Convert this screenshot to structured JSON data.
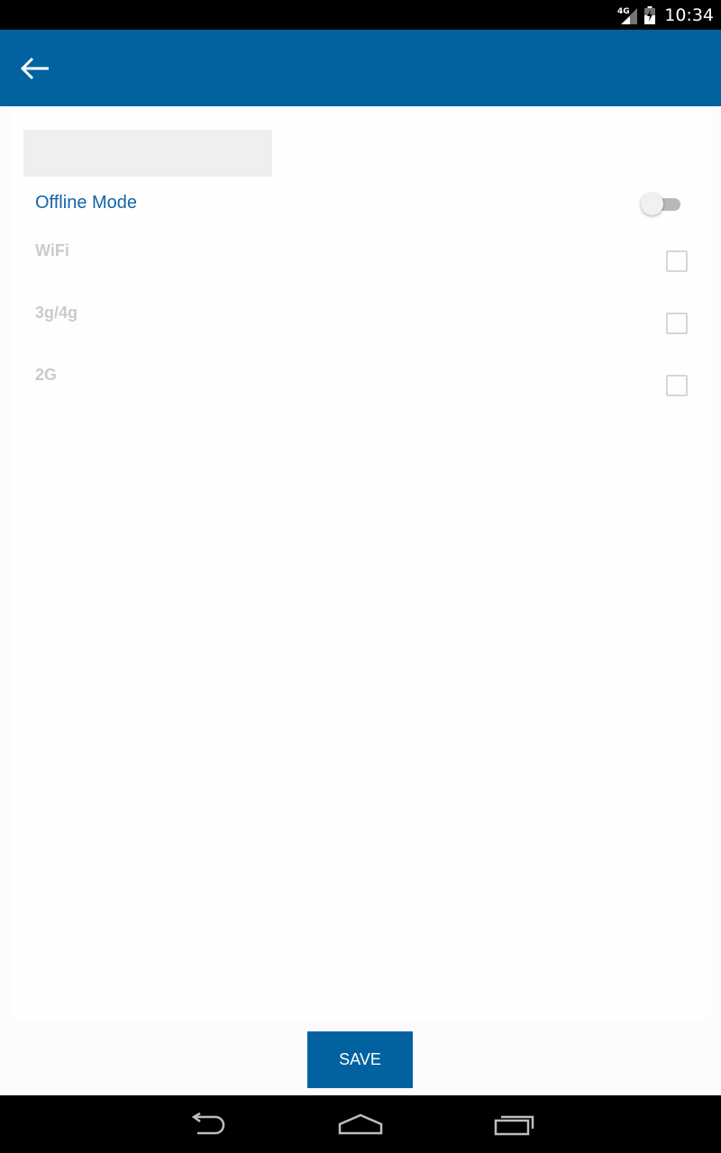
{
  "status_bar": {
    "network": "4G",
    "time": "10:34"
  },
  "settings": {
    "offline_mode": {
      "label": "Offline Mode",
      "enabled": false
    },
    "options": [
      {
        "label": "WiFi",
        "checked": false
      },
      {
        "label": "3g/4g",
        "checked": false
      },
      {
        "label": "2G",
        "checked": false
      }
    ]
  },
  "actions": {
    "save_label": "SAVE"
  },
  "colors": {
    "primary": "#0262a0",
    "label_blue": "#1565a6",
    "disabled_text": "#cbcbcb"
  },
  "icons": {
    "app_bar": "arrow-back-icon",
    "nav": [
      "nav-back-icon",
      "nav-home-icon",
      "nav-recents-icon"
    ]
  }
}
